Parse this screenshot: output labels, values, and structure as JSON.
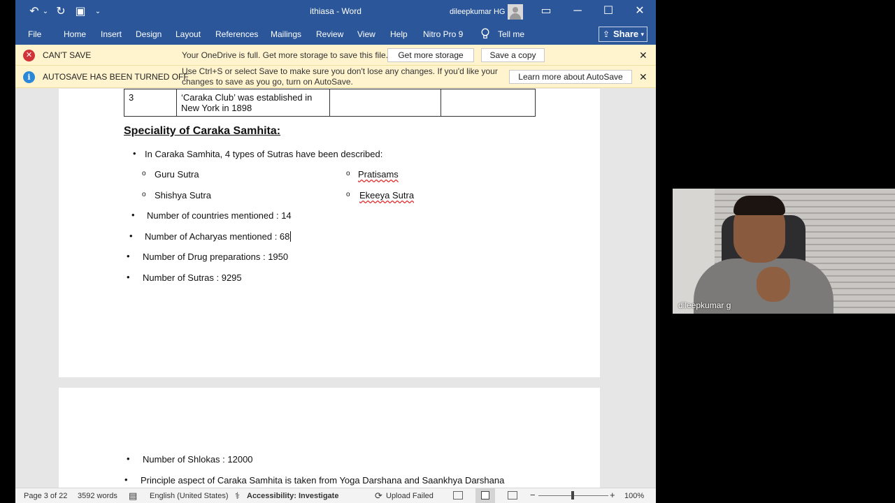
{
  "window": {
    "title": "ithiasa  -  Word",
    "user_name": "dileepkumar HG",
    "qat_undo": "↶",
    "qat_undo_dropdown": "⌄",
    "qat_redo": "↻",
    "qat_save": "▣",
    "qat_customize": "⌄",
    "ribbon_display": "▭",
    "minimize": "─",
    "maximize": "☐",
    "close": "✕"
  },
  "ribbon": {
    "tabs": [
      "File",
      "Home",
      "Insert",
      "Design",
      "Layout",
      "References",
      "Mailings",
      "Review",
      "View",
      "Help",
      "Nitro Pro 9"
    ],
    "tell_me": "Tell me",
    "share_label": "Share",
    "share_icon": "⇪",
    "share_chevron": "▾",
    "tell_me_icon": "lightbulb-icon"
  },
  "messages": {
    "cant_save": {
      "icon": "✕",
      "icon_color": "#d13438",
      "title": "CAN'T SAVE",
      "text": "Your OneDrive is full. Get more storage to save this file.",
      "button1": "Get more storage",
      "button2": "Save a copy",
      "close": "✕"
    },
    "autosave": {
      "icon": "i",
      "icon_color": "#2b88d8",
      "title": "AUTOSAVE HAS BEEN TURNED OFF",
      "text_line1": "Use Ctrl+S or select Save to make sure you don't lose any changes. If you'd like your",
      "text_line2": "changes to save as you go, turn on AutoSave.",
      "button": "Learn more about AutoSave",
      "close": "✕"
    }
  },
  "document": {
    "table_row3": {
      "number": "3",
      "text_line1": "‘Caraka Club’ was established in",
      "text_line2": "New York in 1898"
    },
    "heading": "Speciality of Caraka Samhita:",
    "bullet_sutras": "In Caraka Samhita, 4 types of Sutras have been described:",
    "sutras": [
      "Guru Sutra",
      "Shishya Sutra",
      "Pratisams",
      "Ekeeya Sutra"
    ],
    "bullet_countries": "Number of countries mentioned : 14",
    "bullet_acharyas": "Number of Acharyas mentioned : 68",
    "bullet_drugs": "Number of Drug preparations : 1950",
    "bullet_sutras_count": "Number of Sutras : 9295",
    "bullet_shlokas": "Number of Shlokas : 12000",
    "bullet_principle": "Principle aspect of Caraka Samhita is taken from Yoga Darshana and Saankhya Darshana",
    "bullet_char": "•",
    "sub_bullet_char": "o"
  },
  "statusbar": {
    "page": "Page 3 of 22",
    "words": "3592 words",
    "proofing_icon": "▤",
    "language": "English (United States)",
    "accessibility_icon": "⚕",
    "accessibility": "Accessibility: Investigate",
    "upload_icon": "⟳",
    "upload": "Upload Failed",
    "zoom_out": "−",
    "zoom_in": "+",
    "zoom": "100%"
  },
  "webcam": {
    "name": "dileepkumar g"
  },
  "colors": {
    "ribbon": "#2b579a",
    "message_bar": "#fff4ce",
    "spell_underline": "#e03030"
  }
}
